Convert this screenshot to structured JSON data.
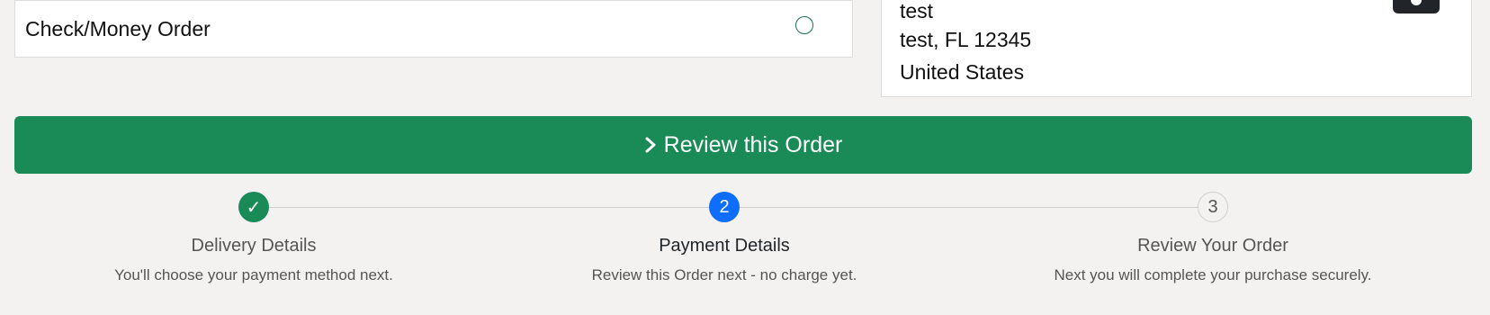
{
  "payment": {
    "option_label": "Check/Money Order"
  },
  "address": {
    "line1": "test",
    "line2": "test, FL 12345",
    "line3": "United States"
  },
  "review_button": {
    "label": "Review this Order"
  },
  "steps": [
    {
      "number": "✓",
      "title": "Delivery Details",
      "description": "You'll choose your payment method next.",
      "state": "done"
    },
    {
      "number": "2",
      "title": "Payment Details",
      "description": "Review this Order next - no charge yet.",
      "state": "active"
    },
    {
      "number": "3",
      "title": "Review Your Order",
      "description": "Next you will complete your purchase securely.",
      "state": "pending"
    }
  ],
  "colors": {
    "primary_green": "#1a8a57",
    "active_blue": "#0d6efd",
    "background": "#f3f2f1"
  }
}
